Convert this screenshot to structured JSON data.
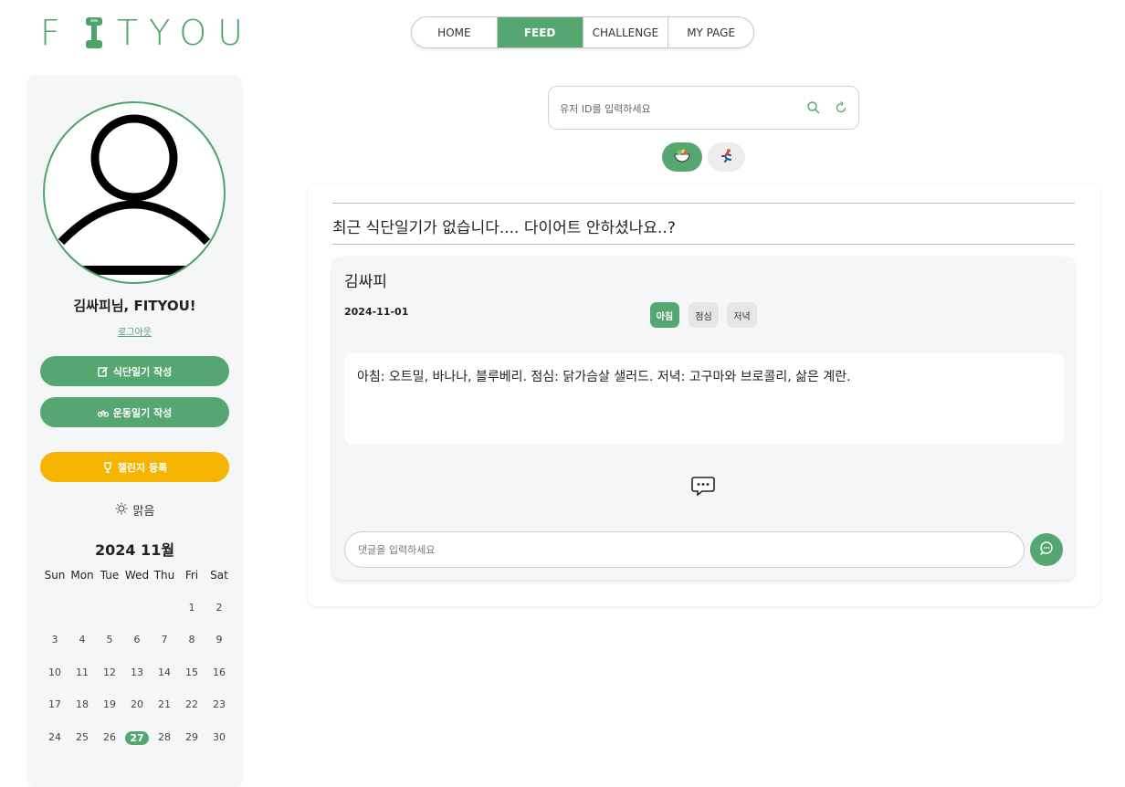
{
  "app": {
    "logo_text": "FITYOU",
    "brand_color": "#55a671",
    "accent_yellow": "#f4b400"
  },
  "nav": {
    "items": [
      {
        "label": "HOME",
        "active": false
      },
      {
        "label": "FEED",
        "active": true
      },
      {
        "label": "CHALLENGE",
        "active": false
      },
      {
        "label": "MY PAGE",
        "active": false
      }
    ]
  },
  "sidebar": {
    "greeting": "김싸피님, FITYOU!",
    "logout_label": "로그아웃",
    "buttons": {
      "diet_diary": "식단일기 작성",
      "exercise_diary": "운동일기 작성",
      "challenge_register": "챌린지 등록"
    },
    "weather": {
      "icon": "sun-icon",
      "label": "맑음"
    },
    "calendar": {
      "title": "2024 11월",
      "weekdays": [
        "Sun",
        "Mon",
        "Tue",
        "Wed",
        "Thu",
        "Fri",
        "Sat"
      ],
      "weeks": [
        [
          "",
          "",
          "",
          "",
          "",
          "1",
          "2"
        ],
        [
          "3",
          "4",
          "5",
          "6",
          "7",
          "8",
          "9"
        ],
        [
          "10",
          "11",
          "12",
          "13",
          "14",
          "15",
          "16"
        ],
        [
          "17",
          "18",
          "19",
          "20",
          "21",
          "22",
          "23"
        ],
        [
          "24",
          "25",
          "26",
          "27",
          "28",
          "29",
          "30"
        ]
      ],
      "today": "27"
    }
  },
  "search": {
    "placeholder": "유저 ID를 입력하세요"
  },
  "filters": {
    "diet_icon": "salad-icon",
    "exercise_icon": "runner-icon",
    "active": "diet"
  },
  "feed": {
    "notice": "최근 식단일기가 없습니다.... 다이어트 안하셨나요..?",
    "post": {
      "user": "김싸피",
      "date": "2024-11-01",
      "meal_tabs": [
        "아침",
        "점심",
        "저녁"
      ],
      "active_meal": "아침",
      "content": "아침: 오트밀, 바나나, 블루베리. 점심: 닭가슴살 샐러드. 저녁: 고구마와 브로콜리, 삶은 계란.",
      "comment_placeholder": "댓글을 입력하세요"
    }
  }
}
